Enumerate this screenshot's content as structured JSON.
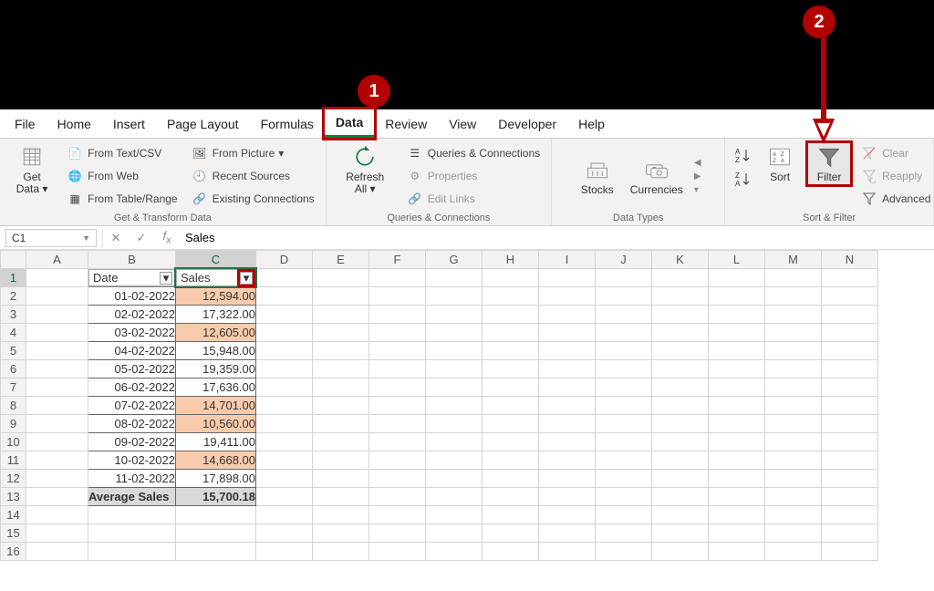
{
  "tabs": [
    "File",
    "Home",
    "Insert",
    "Page Layout",
    "Formulas",
    "Data",
    "Review",
    "View",
    "Developer",
    "Help"
  ],
  "active_tab_index": 5,
  "ribbon": {
    "get_data": "Get\nData",
    "from_text": "From Text/CSV",
    "from_web": "From Web",
    "from_table": "From Table/Range",
    "from_picture": "From Picture",
    "recent_sources": "Recent Sources",
    "existing_conn": "Existing Connections",
    "grp_transform": "Get & Transform Data",
    "refresh_all": "Refresh\nAll",
    "queries_conn": "Queries & Connections",
    "properties": "Properties",
    "edit_links": "Edit Links",
    "grp_queries": "Queries & Connections",
    "stocks": "Stocks",
    "currencies": "Currencies",
    "grp_types": "Data Types",
    "sort": "Sort",
    "filter": "Filter",
    "clear": "Clear",
    "reapply": "Reapply",
    "advanced": "Advanced",
    "grp_sort": "Sort & Filter"
  },
  "namebox": "C1",
  "formula": "Sales",
  "columns": [
    "A",
    "B",
    "C",
    "D",
    "E",
    "F",
    "G",
    "H",
    "I",
    "J",
    "K",
    "L",
    "M",
    "N"
  ],
  "row_count": 16,
  "headers": {
    "date": "Date",
    "sales": "Sales"
  },
  "rows": [
    {
      "date": "01-02-2022",
      "sales": "12,594.00",
      "below": true
    },
    {
      "date": "02-02-2022",
      "sales": "17,322.00",
      "below": false
    },
    {
      "date": "03-02-2022",
      "sales": "12,605.00",
      "below": true
    },
    {
      "date": "04-02-2022",
      "sales": "15,948.00",
      "below": false
    },
    {
      "date": "05-02-2022",
      "sales": "19,359.00",
      "below": false
    },
    {
      "date": "06-02-2022",
      "sales": "17,636.00",
      "below": false
    },
    {
      "date": "07-02-2022",
      "sales": "14,701.00",
      "below": true
    },
    {
      "date": "08-02-2022",
      "sales": "10,560.00",
      "below": true
    },
    {
      "date": "09-02-2022",
      "sales": "19,411.00",
      "below": false
    },
    {
      "date": "10-02-2022",
      "sales": "14,668.00",
      "below": true
    },
    {
      "date": "11-02-2022",
      "sales": "17,898.00",
      "below": false
    }
  ],
  "summary": {
    "label": "Average Sales",
    "value": "15,700.18"
  },
  "callouts": {
    "one": "1",
    "two": "2"
  },
  "col_widths": {
    "A": 68,
    "B": 96,
    "C": 88,
    "rest": 62
  }
}
